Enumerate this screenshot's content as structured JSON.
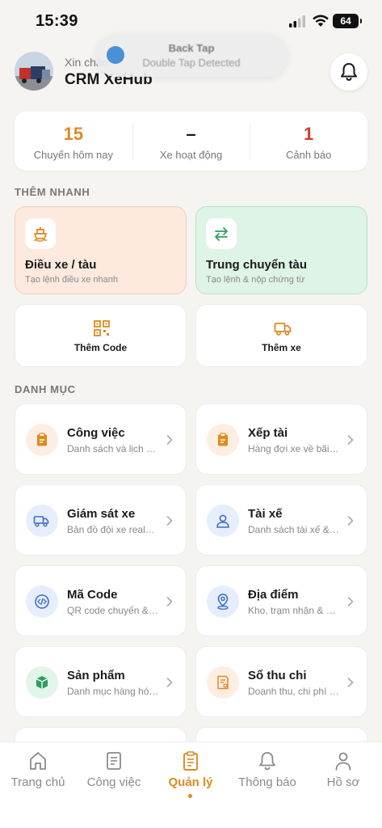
{
  "status_bar": {
    "time": "15:39",
    "battery": "64"
  },
  "toast": {
    "title": "Back Tap",
    "subtitle": "Double Tap Detected"
  },
  "header": {
    "greeting": "Xin chào",
    "app_name": "CRM XeHub"
  },
  "stats": [
    {
      "value": "15",
      "label": "Chuyến hôm nay",
      "color": "#e08a1f"
    },
    {
      "value": "–",
      "label": "Xe hoạt động",
      "color": "#1a1a1a"
    },
    {
      "value": "1",
      "label": "Cảnh báo",
      "color": "#d23b2f"
    }
  ],
  "quick_add": {
    "section_title": "THÊM NHANH",
    "primary": [
      {
        "title": "Điều xe / tàu",
        "subtitle": "Tạo lệnh điều xe nhanh",
        "icon": "ship-icon"
      },
      {
        "title": "Trung chuyển tàu",
        "subtitle": "Tạo lệnh & nộp chứng từ",
        "icon": "transfer-arrows-icon"
      }
    ],
    "secondary": [
      {
        "label": "Thêm Code",
        "icon": "qr-code-icon"
      },
      {
        "label": "Thêm xe",
        "icon": "truck-icon"
      }
    ]
  },
  "categories": {
    "section_title": "DANH MỤC",
    "items": [
      {
        "title": "Công việc",
        "subtitle": "Danh sách và lịch …",
        "icon": "clipboard-icon",
        "color": "orange"
      },
      {
        "title": "Xếp tài",
        "subtitle": "Hàng đợi xe về bãi…",
        "icon": "clipboard-icon",
        "color": "orange"
      },
      {
        "title": "Giám sát xe",
        "subtitle": "Bản đồ đội xe real…",
        "icon": "truck-monitor-icon",
        "color": "blue"
      },
      {
        "title": "Tài xế",
        "subtitle": "Danh sách tài xế &…",
        "icon": "user-icon",
        "color": "blue"
      },
      {
        "title": "Mã Code",
        "subtitle": "QR code chuyến & …",
        "icon": "code-icon",
        "color": "blue"
      },
      {
        "title": "Địa điểm",
        "subtitle": "Kho, trạm nhận & …",
        "icon": "location-pin-icon",
        "color": "blue"
      },
      {
        "title": "Sản phẩm",
        "subtitle": "Danh mục hàng hó…",
        "icon": "box-icon",
        "color": "green"
      },
      {
        "title": "Sổ thu chi",
        "subtitle": "Doanh thu, chi phí …",
        "icon": "receipt-icon",
        "color": "orange"
      }
    ]
  },
  "bottom_nav": [
    {
      "label": "Trang chủ",
      "icon": "home-icon"
    },
    {
      "label": "Công việc",
      "icon": "document-icon"
    },
    {
      "label": "Quản lý",
      "icon": "manage-icon",
      "active": true
    },
    {
      "label": "Thông báo",
      "icon": "bell-icon"
    },
    {
      "label": "Hồ sơ",
      "icon": "profile-icon"
    }
  ]
}
